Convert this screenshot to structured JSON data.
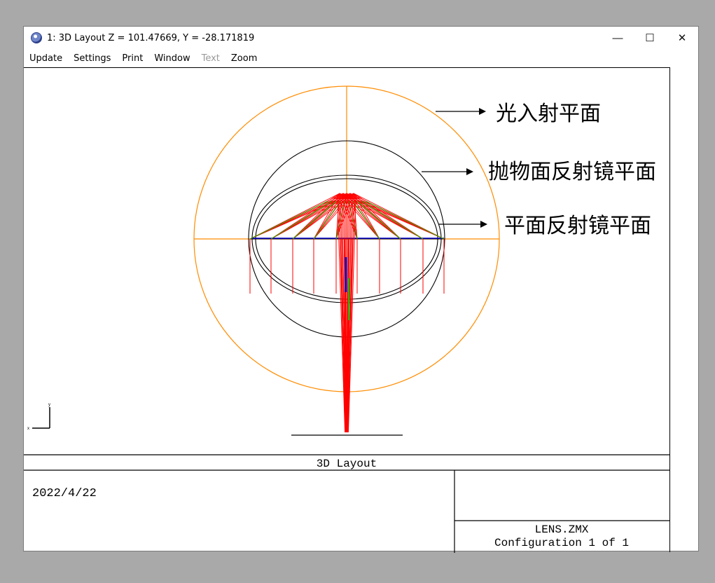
{
  "window": {
    "title": "1: 3D Layout Z = 101.47669, Y = -28.171819",
    "controls": {
      "minimize": "—",
      "maximize": "☐",
      "close": "✕"
    }
  },
  "menu": {
    "items": [
      {
        "label": "Update",
        "enabled": true
      },
      {
        "label": "Settings",
        "enabled": true
      },
      {
        "label": "Print",
        "enabled": true
      },
      {
        "label": "Window",
        "enabled": true
      },
      {
        "label": "Text",
        "enabled": false
      },
      {
        "label": "Zoom",
        "enabled": true
      }
    ]
  },
  "annotations": {
    "light_plane": "光入射平面",
    "parabolic_mirror_plane": "抛物面反射镜平面",
    "flat_mirror_plane": "平面反射镜平面"
  },
  "axis_indicator": {
    "x": "x",
    "y": "y"
  },
  "title_block": {
    "plot_title": "3D Layout",
    "date": "2022/4/22",
    "file": "LENS.ZMX",
    "configuration": "Configuration 1 of 1"
  },
  "colors": {
    "rays_red": "#ff0000",
    "rays_green": "#00cc00",
    "rays_blue": "#0000cc",
    "orange_plane": "#ff8c00",
    "outline": "#000000"
  }
}
